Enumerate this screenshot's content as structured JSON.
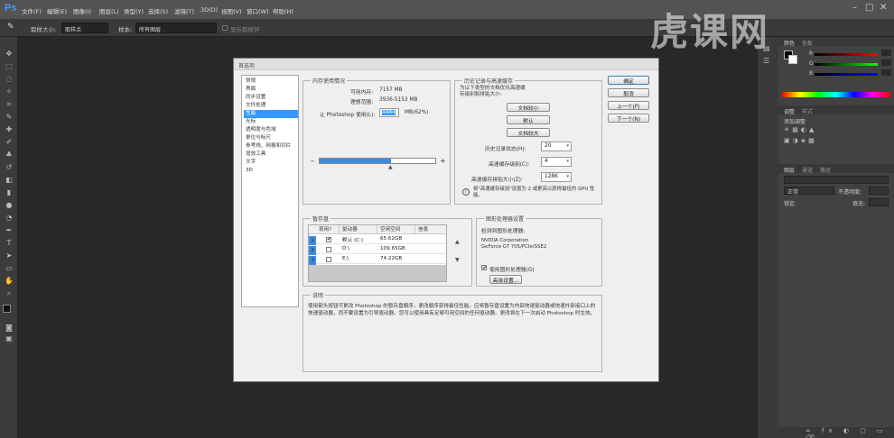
{
  "app": {
    "logo": "Ps",
    "window_controls": [
      "–",
      "□",
      "✕"
    ]
  },
  "menu": [
    "文件(F)",
    "编辑(E)",
    "图像(I)",
    "图层(L)",
    "类型(Y)",
    "选择(S)",
    "滤镜(T)",
    "3D(D)",
    "视图(V)",
    "窗口(W)",
    "帮助(H)"
  ],
  "options_bar": {
    "sample_size_label": "取样大小:",
    "sample_size_value": "取样点",
    "sample_label": "样本:",
    "sample_value": "所有图层",
    "show_ring_label": "显示取样环"
  },
  "watermark": "虎课网",
  "dialog": {
    "title": "首选项",
    "nav_items": [
      "常规",
      "界面",
      "同步设置",
      "文件处理",
      "性能",
      "光标",
      "透明度与色域",
      "单位与标尺",
      "参考线、网格和切片",
      "增效工具",
      "文字",
      "3D"
    ],
    "active_nav": "性能",
    "buttons": {
      "ok": "确定",
      "cancel": "取消",
      "prev": "上一个(P)",
      "next": "下一个(N)"
    },
    "memory": {
      "title": "内存使用情况",
      "available_label": "可用内存:",
      "available_value": "7157 MB",
      "ideal_label": "理想范围:",
      "ideal_value": "3936-5153 MB",
      "usage_label": "让 Photoshop 使用(L):",
      "usage_value": "4484",
      "usage_suffix": "MB(62%)",
      "usage_percent": 62,
      "minus": "–",
      "plus": "+"
    },
    "history": {
      "title": "历史记录与高速缓存",
      "desc": "为以下类型的文档优化高速缓存级别和拼贴大小:",
      "btn_small": "文档较小",
      "btn_default": "默认",
      "btn_large": "文档较大",
      "states_label": "历史记录状态(H):",
      "states_value": "20",
      "levels_label": "高速缓存级别(C):",
      "levels_value": "4",
      "tile_label": "高速缓存拼贴大小(Z):",
      "tile_value": "128K",
      "note": "将\"高速缓存级别\"设置为 2 或更高以获得最佳的 GPU 性能。"
    },
    "scratch": {
      "title": "暂存盘",
      "headers": [
        "现用?",
        "驱动器",
        "空闲空间",
        "信息"
      ],
      "rows": [
        {
          "num": "1",
          "checked": "✔",
          "drive": "默认 (C:)",
          "free": "65.62GB"
        },
        {
          "num": "2",
          "checked": "",
          "drive": "D:\\",
          "free": "109.65GB"
        },
        {
          "num": "3",
          "checked": "",
          "drive": "E:\\",
          "free": "74.22GB"
        }
      ],
      "up": "▲",
      "down": "▼"
    },
    "gpu": {
      "title": "图形处理器设置",
      "detected_label": "检测到图形处理器:",
      "vendor": "NVIDIA Corporation",
      "model": "GeForce GT 705/PCIe/SSE2",
      "use_label": "使用图形处理器(G)",
      "advanced": "高级设置..."
    },
    "description": {
      "title": "说明",
      "text": "使用箭头按钮可更改 Photoshop 的暂存盘顺序，更改顺序获得最佳性能。应将暂存盘设置为内部快速驱动器或快速外部接口上的快速驱动器，而不要设置为引导驱动器。您可以使用具有足够可用空间的任何驱动器。更改将在下一次启动 Photoshop 时生效。"
    }
  },
  "right_panel": {
    "color_tabs": [
      "颜色",
      "色板"
    ],
    "rgb": [
      "R",
      "G",
      "B"
    ],
    "adj_tabs": [
      "调整",
      "样式"
    ],
    "adj_label": "添加调整",
    "layer_tabs": [
      "图层",
      "通道",
      "路径"
    ],
    "blend_mode": "正常",
    "opacity_label": "不透明度:",
    "lock_label": "锁定:",
    "fill_label": "填充:"
  }
}
